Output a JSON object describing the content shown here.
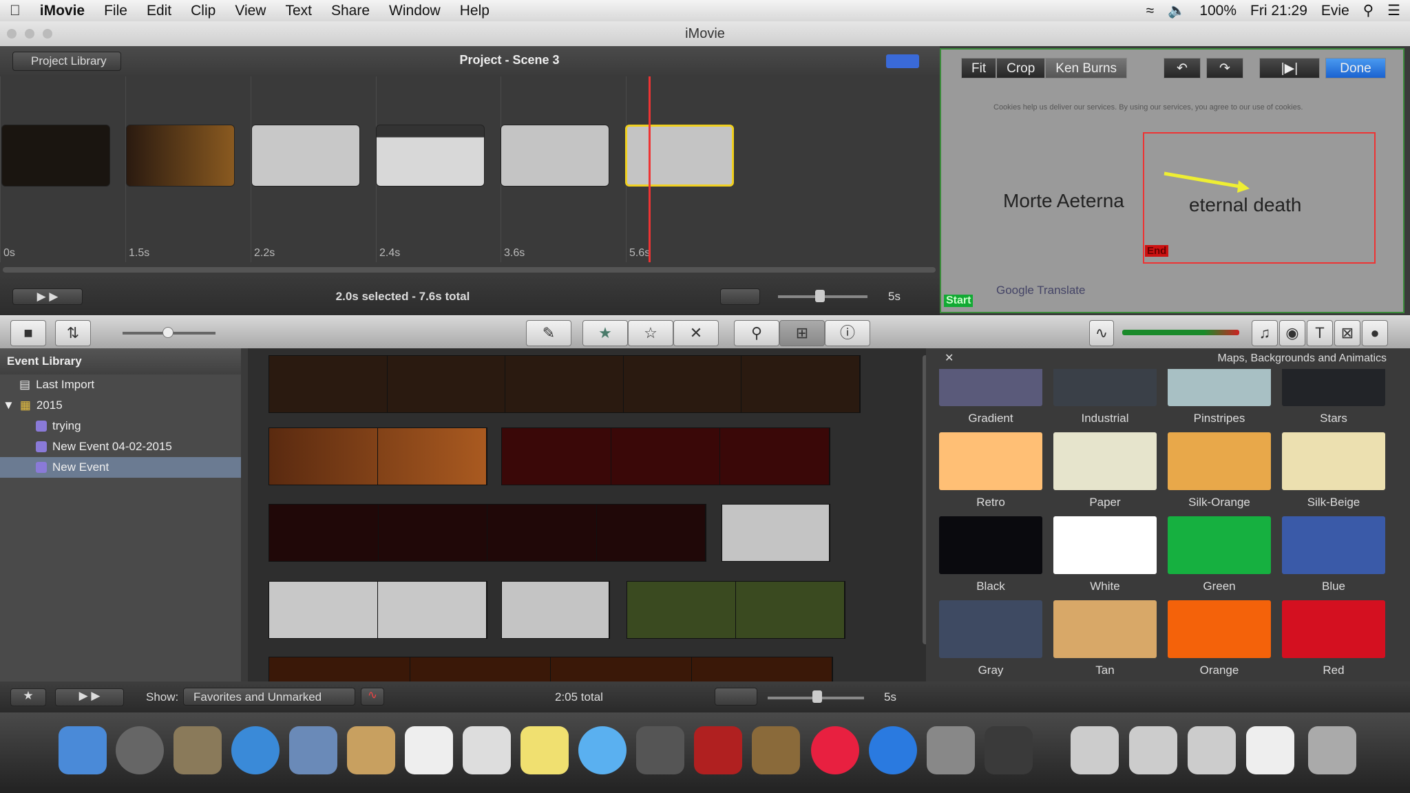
{
  "menubar": {
    "app": "iMovie",
    "items": [
      "File",
      "Edit",
      "Clip",
      "View",
      "Text",
      "Share",
      "Window",
      "Help"
    ],
    "battery": "100%",
    "clock": "Fri 21:29",
    "user": "Evie"
  },
  "window": {
    "title": "iMovie"
  },
  "project": {
    "back_label": "Project Library",
    "title": "Project - Scene 3",
    "ticks": [
      "0s",
      "1.5s",
      "2.2s",
      "2.4s",
      "3.6s",
      "5.6s"
    ],
    "status": "2.0s selected - 7.6s total",
    "zoom_label": "5s"
  },
  "viewer": {
    "modes": [
      "Fit",
      "Crop",
      "Ken Burns"
    ],
    "done_label": "Done",
    "start_label": "Start",
    "end_label": "End",
    "cookie_text": "Cookies help us deliver our services. By using our services, you agree to our use of cookies.",
    "source_text": "Morte Aeterna",
    "target_text": "eternal death",
    "footer": "Google Translate"
  },
  "events": {
    "header": "Event Library",
    "items": [
      {
        "label": "Last Import"
      },
      {
        "label": "2015"
      },
      {
        "label": "trying"
      },
      {
        "label": "New Event 04-02-2015"
      },
      {
        "label": "New Event"
      }
    ]
  },
  "panel": {
    "title": "Maps, Backgrounds and Animatics",
    "items": [
      {
        "label": "Gradient",
        "color": "#5a5a7a"
      },
      {
        "label": "Industrial",
        "color": "#3a4048"
      },
      {
        "label": "Pinstripes",
        "color": "#a8c0c4"
      },
      {
        "label": "Stars",
        "color": "#222428"
      },
      {
        "label": "Retro",
        "color": "#ffbf75"
      },
      {
        "label": "Paper",
        "color": "#e6e4cc"
      },
      {
        "label": "Silk-Orange",
        "color": "#e8a84a"
      },
      {
        "label": "Silk-Beige",
        "color": "#ece0b0"
      },
      {
        "label": "Black",
        "color": "#0a0a0e"
      },
      {
        "label": "White",
        "color": "#ffffff"
      },
      {
        "label": "Green",
        "color": "#16b040"
      },
      {
        "label": "Blue",
        "color": "#3a5aa8"
      },
      {
        "label": "Gray",
        "color": "#3e4a62"
      },
      {
        "label": "Tan",
        "color": "#d8a868"
      },
      {
        "label": "Orange",
        "color": "#f4620a"
      },
      {
        "label": "Red",
        "color": "#d41020"
      }
    ]
  },
  "bottom": {
    "show_label": "Show:",
    "filter": "Favorites and Unmarked",
    "total": "2:05 total",
    "zoom_label": "5s"
  }
}
